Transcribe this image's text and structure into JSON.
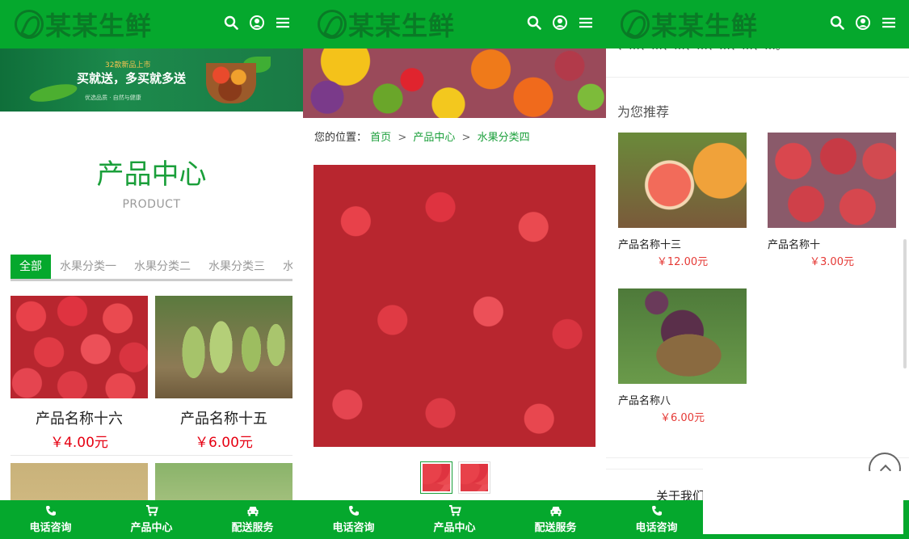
{
  "brand": {
    "name": "某某生鲜"
  },
  "header_icons": [
    "search-icon",
    "user-icon",
    "menu-icon"
  ],
  "footer_nav": [
    {
      "label": "电话咨询",
      "icon": "phone-icon"
    },
    {
      "label": "产品中心",
      "icon": "cart-icon"
    },
    {
      "label": "配送服务",
      "icon": "car-icon"
    }
  ],
  "list_page": {
    "banner": {
      "tag": "32款新品上市",
      "headline": "买就送，多买就多送",
      "sub": "优选品质 · 自然与健康"
    },
    "section_title": "产品中心",
    "section_subtitle": "PRODUCT",
    "tabs": [
      "全部",
      "水果分类一",
      "水果分类二",
      "水果分类三",
      "水"
    ],
    "products": [
      {
        "name": "产品名称十六",
        "price": "￥4.00元"
      },
      {
        "name": "产品名称十五",
        "price": "￥6.00元"
      }
    ]
  },
  "detail_page": {
    "breadcrumb": {
      "label": "您的位置：",
      "items": [
        "首页",
        "产品中心",
        "水果分类四"
      ],
      "separator": ">"
    }
  },
  "recommend_page": {
    "top_text": "、…、…、…、…、…、…、…。",
    "title": "为您推荐",
    "items": [
      {
        "name": "产品名称十三",
        "price": "￥12.00元"
      },
      {
        "name": "产品名称十",
        "price": "￥3.00元"
      },
      {
        "name": "产品名称八",
        "price": "￥6.00元"
      }
    ],
    "about_label": "关于我们"
  },
  "colors": {
    "brand_green": "#05a82d",
    "price_red": "#e60012",
    "link_green": "#1a9f3a"
  }
}
